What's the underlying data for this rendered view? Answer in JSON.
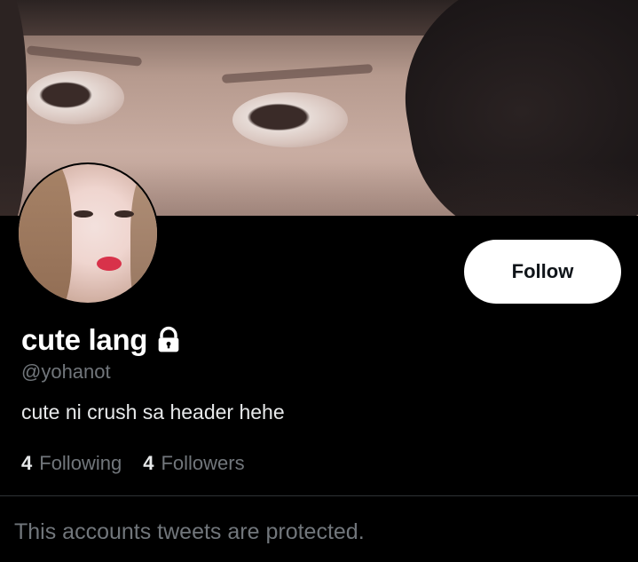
{
  "profile": {
    "display_name": "cute lang",
    "handle": "@yohanot",
    "bio": "cute ni crush sa header hehe",
    "protected": true
  },
  "stats": {
    "following_count": "4",
    "following_label": "Following",
    "followers_count": "4",
    "followers_label": "Followers"
  },
  "actions": {
    "follow_label": "Follow"
  },
  "timeline": {
    "protected_message": "This accounts tweets are protected."
  },
  "icons": {
    "lock": "lock-icon"
  },
  "colors": {
    "background": "#000000",
    "secondary_text": "#71767b",
    "button_bg": "#ffffff",
    "button_text": "#0f1419"
  }
}
